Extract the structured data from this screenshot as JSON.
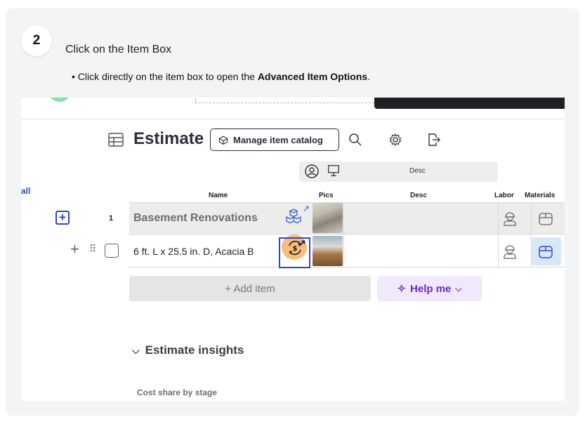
{
  "step": {
    "number": "2",
    "title": "Click on the Item Box",
    "desc_prefix": "• Click directly on the item box to open the ",
    "desc_bold": "Advanced Item Options",
    "desc_suffix": "."
  },
  "toolbar": {
    "title": "Estimate",
    "catalog_button": "Manage item catalog"
  },
  "filters": {
    "desc_label": "Desc"
  },
  "table": {
    "all_label": "all",
    "columns": {
      "name": "Name",
      "pics": "Pics",
      "desc": "Desc",
      "labor": "Labor",
      "materials": "Materials"
    },
    "group": {
      "number": "1",
      "name": "Basement Renovations"
    },
    "item": {
      "name": "6 ft. L x 25.5 in. D, Acacia B"
    },
    "add_item": "+ Add item",
    "help_me": "Help me"
  },
  "insights": {
    "title": "Estimate insights",
    "cost_share": "Cost share by stage"
  },
  "colors": {
    "accent": "#2b4ac7",
    "help": "#6b2db8",
    "click_marker": "#f5a650"
  }
}
